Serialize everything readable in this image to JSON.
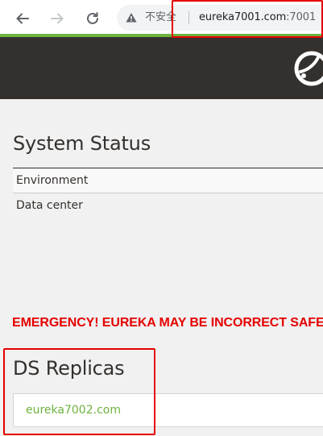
{
  "browser": {
    "security_label": "不安全",
    "url_host": "eureka7001.com",
    "url_port": ":7001"
  },
  "colors": {
    "header_bg": "#34302d",
    "accent_green": "#6db33f",
    "emergency_red": "#e60000",
    "highlight_box": "#e60000"
  },
  "icons": [
    "back-arrow-icon",
    "forward-arrow-icon",
    "reload-icon",
    "warning-triangle-icon",
    "spring-logo-icon"
  ],
  "system_status": {
    "title": "System Status",
    "rows": [
      {
        "label": "Environment",
        "value": ""
      },
      {
        "label": "Data center",
        "value": ""
      }
    ]
  },
  "alert": {
    "text": "EMERGENCY! EUREKA MAY BE INCORRECT SAFE."
  },
  "ds_replicas": {
    "title": "DS Replicas",
    "items": [
      {
        "label": "eureka7002.com"
      }
    ]
  }
}
